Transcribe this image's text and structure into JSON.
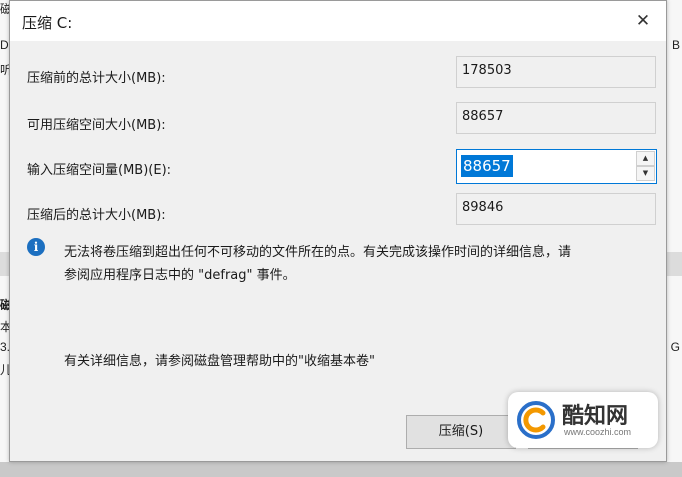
{
  "background": {
    "left_fragments": [
      "磁",
      "DS",
      "听",
      "磁",
      "本",
      "3.",
      "儿"
    ],
    "right_fragments": [
      "B",
      "G"
    ]
  },
  "dialog": {
    "title": "压缩 C:",
    "close_glyph": "✕",
    "rows": [
      {
        "label": "压缩前的总计大小(MB):",
        "value": "178503"
      },
      {
        "label": "可用压缩空间大小(MB):",
        "value": "88657"
      },
      {
        "label": "输入压缩空间量(MB)(E):",
        "value": "88657"
      },
      {
        "label": "压缩后的总计大小(MB):",
        "value": "89846"
      }
    ],
    "spin_up": "▲",
    "spin_down": "▼",
    "info_icon": "i",
    "info_line1": "无法将卷压缩到超出任何不可移动的文件所在的点。有关完成该操作时间的详细信息，请",
    "info_line2": "参阅应用程序日志中的 \"defrag\" 事件。",
    "help_text": "有关详细信息，请参阅磁盘管理帮助中的\"收缩基本卷\"",
    "shrink_button": "压缩(S)"
  },
  "watermark": {
    "name": "酷知网",
    "url": "www.coozhi.com",
    "colors": {
      "accent_orange": "#f39800",
      "accent_blue": "#2a6fc9"
    }
  }
}
